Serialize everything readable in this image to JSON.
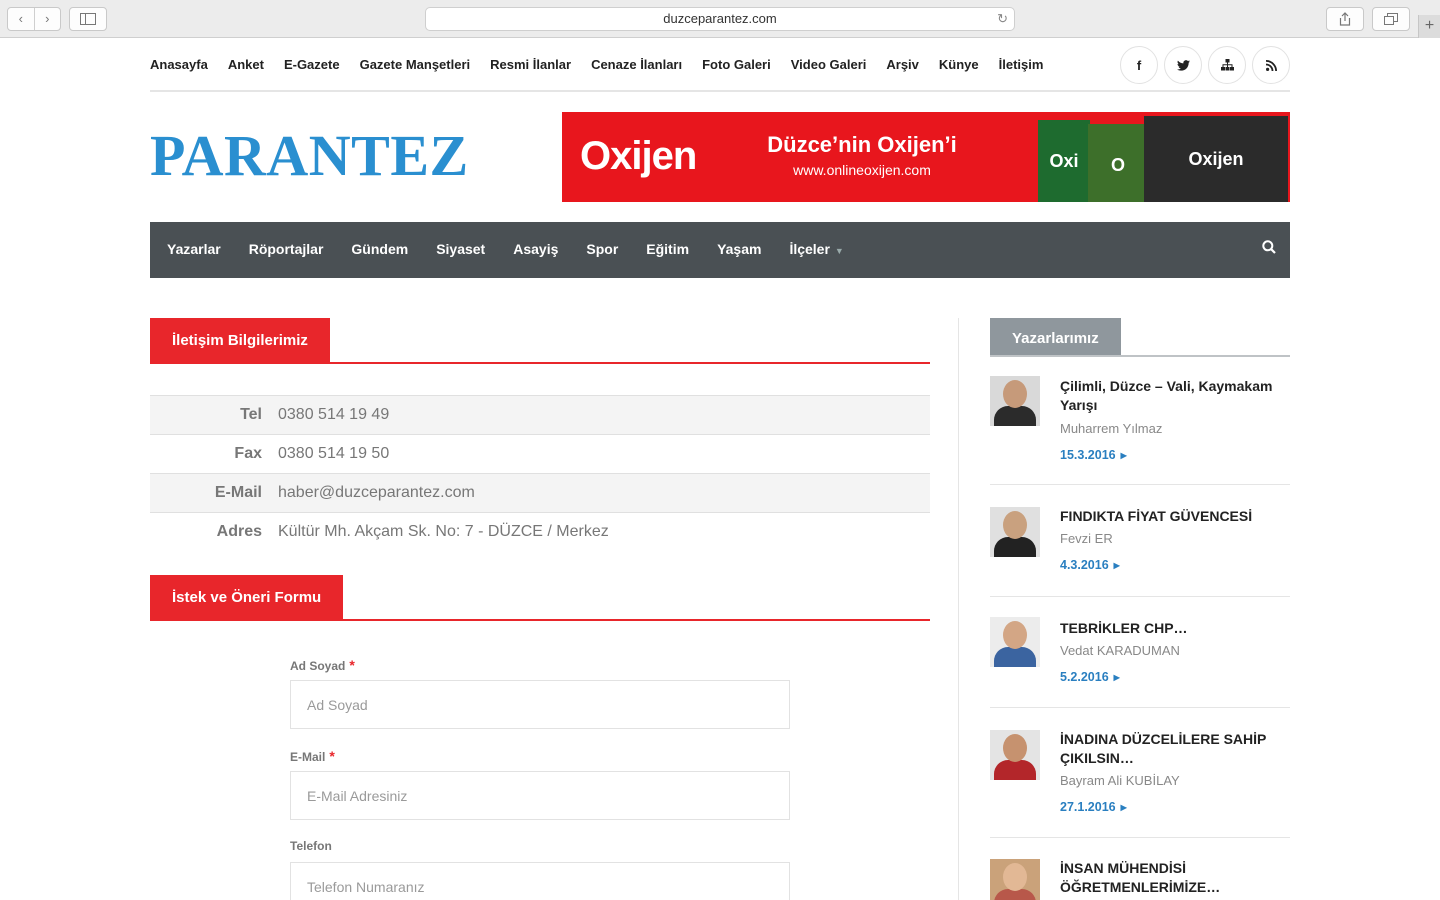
{
  "browser": {
    "url": "duzceparantez.com"
  },
  "topnav": {
    "items": [
      "Anasayfa",
      "Anket",
      "E-Gazete",
      "Gazete Manşetleri",
      "Resmi İlanlar",
      "Cenaze İlanları",
      "Foto Galeri",
      "Video Galeri",
      "Arşiv",
      "Künye",
      "İletişim"
    ],
    "social": [
      "facebook-icon",
      "twitter-icon",
      "sitemap-icon",
      "rss-icon"
    ]
  },
  "header": {
    "logo": "PARANTEZ",
    "banner": {
      "brand": "Oxijen",
      "slogan": "Düzce’nin Oxijen’i",
      "url": "www.onlineoxijen.com",
      "cover_texts": [
        "Oxi",
        "O",
        "Oxijen"
      ]
    }
  },
  "mainnav": {
    "items": [
      "Yazarlar",
      "Röportajlar",
      "Gündem",
      "Siyaset",
      "Asayiş",
      "Spor",
      "Eğitim",
      "Yaşam",
      "İlçeler"
    ]
  },
  "contact": {
    "heading": "İletişim Bilgilerimiz",
    "rows": [
      {
        "label": "Tel",
        "value": "0380 514 19 49"
      },
      {
        "label": "Fax",
        "value": "0380 514 19 50"
      },
      {
        "label": "E-Mail",
        "value": "haber@duzceparantez.com"
      },
      {
        "label": "Adres",
        "value": "Kültür Mh. Akçam Sk. No: 7 - DÜZCE / Merkez"
      }
    ]
  },
  "form": {
    "heading": "İstek ve Öneri Formu",
    "fields": [
      {
        "label": "Ad Soyad",
        "required": true,
        "placeholder": "Ad Soyad"
      },
      {
        "label": "E-Mail",
        "required": true,
        "placeholder": "E-Mail Adresiniz"
      },
      {
        "label": "Telefon",
        "required": false,
        "placeholder": "Telefon Numaranız"
      }
    ]
  },
  "sidebar": {
    "heading": "Yazarlarımız",
    "authors": [
      {
        "title": "Çilimli, Düzce – Vali, Kaymakam Yarışı",
        "name": "Muharrem Yılmaz",
        "date": "15.3.2016"
      },
      {
        "title": "FINDIKTA FİYAT GÜVENCESİ",
        "name": "Fevzi ER",
        "date": "4.3.2016"
      },
      {
        "title": "TEBRİKLER CHP…",
        "name": "Vedat KARADUMAN",
        "date": "5.2.2016"
      },
      {
        "title": "İNADINA DÜZCELİLERE SAHİP ÇIKILSIN…",
        "name": "Bayram Ali KUBİLAY",
        "date": "27.1.2016"
      },
      {
        "title": "İNSAN MÜHENDİSİ ÖĞRETMENLERİMİZE…",
        "name": "",
        "date": ""
      }
    ]
  },
  "colors": {
    "accent_red": "#e8262b",
    "nav_dark": "#4a5054",
    "logo_blue": "#2a8fd0",
    "link_blue": "#2a7fc0",
    "sidebar_tab_gray": "#8f979d"
  }
}
